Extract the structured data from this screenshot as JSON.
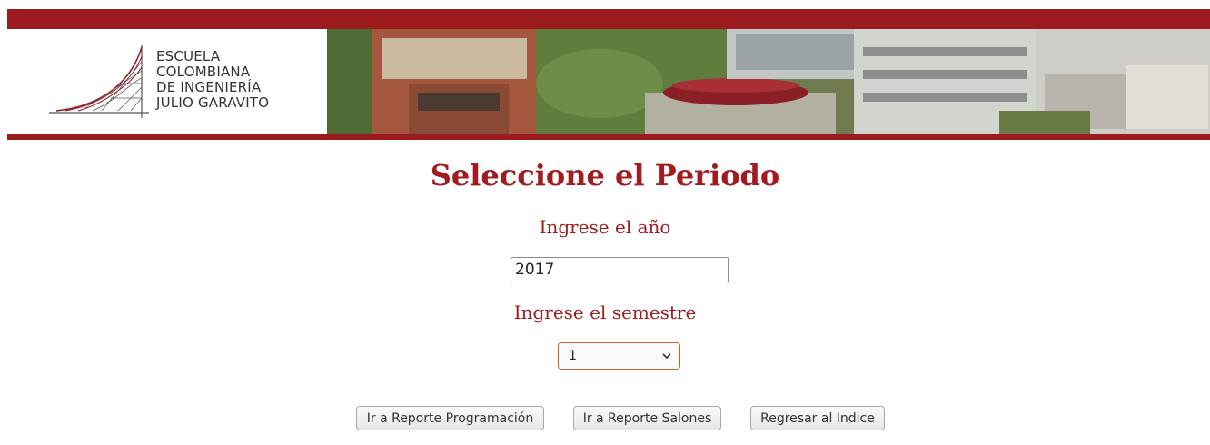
{
  "banner": {
    "logo_lines": [
      "ESCUELA",
      "COLOMBIANA",
      "DE INGENIERÍA",
      "JULIO GARAVITO"
    ],
    "brand_color": "#9b1b1e"
  },
  "main": {
    "title": "Seleccione el Periodo",
    "year_label": "Ingrese el año",
    "year_value": "2017",
    "semester_label": "Ingrese el semestre",
    "semester_selected": "1"
  },
  "buttons": {
    "programacion": "Ir a Reporte Programación",
    "salones": "Ir a Reporte Salones",
    "indice": "Regresar al Indice"
  }
}
